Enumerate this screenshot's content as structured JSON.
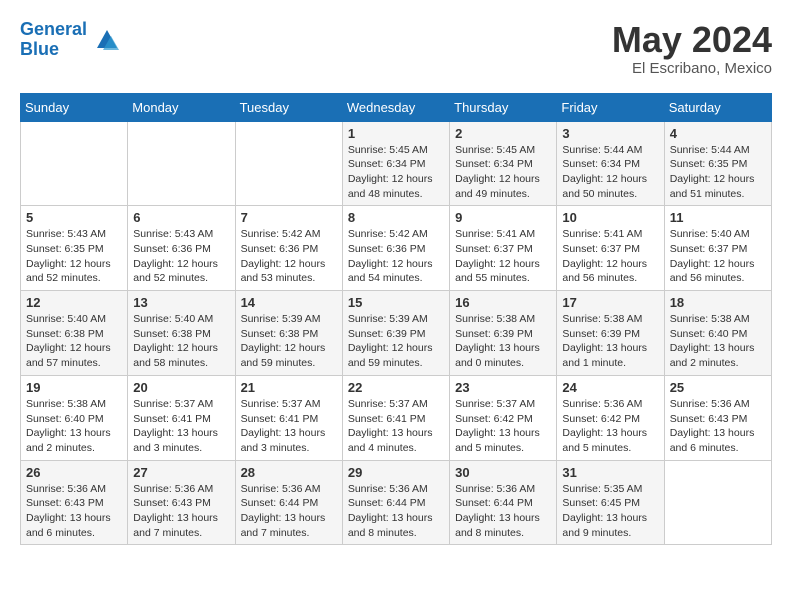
{
  "header": {
    "logo_line1": "General",
    "logo_line2": "Blue",
    "month_title": "May 2024",
    "location": "El Escribano, Mexico"
  },
  "days_of_week": [
    "Sunday",
    "Monday",
    "Tuesday",
    "Wednesday",
    "Thursday",
    "Friday",
    "Saturday"
  ],
  "weeks": [
    [
      {
        "day": "",
        "info": ""
      },
      {
        "day": "",
        "info": ""
      },
      {
        "day": "",
        "info": ""
      },
      {
        "day": "1",
        "info": "Sunrise: 5:45 AM\nSunset: 6:34 PM\nDaylight: 12 hours and 48 minutes."
      },
      {
        "day": "2",
        "info": "Sunrise: 5:45 AM\nSunset: 6:34 PM\nDaylight: 12 hours and 49 minutes."
      },
      {
        "day": "3",
        "info": "Sunrise: 5:44 AM\nSunset: 6:34 PM\nDaylight: 12 hours and 50 minutes."
      },
      {
        "day": "4",
        "info": "Sunrise: 5:44 AM\nSunset: 6:35 PM\nDaylight: 12 hours and 51 minutes."
      }
    ],
    [
      {
        "day": "5",
        "info": "Sunrise: 5:43 AM\nSunset: 6:35 PM\nDaylight: 12 hours and 52 minutes."
      },
      {
        "day": "6",
        "info": "Sunrise: 5:43 AM\nSunset: 6:36 PM\nDaylight: 12 hours and 52 minutes."
      },
      {
        "day": "7",
        "info": "Sunrise: 5:42 AM\nSunset: 6:36 PM\nDaylight: 12 hours and 53 minutes."
      },
      {
        "day": "8",
        "info": "Sunrise: 5:42 AM\nSunset: 6:36 PM\nDaylight: 12 hours and 54 minutes."
      },
      {
        "day": "9",
        "info": "Sunrise: 5:41 AM\nSunset: 6:37 PM\nDaylight: 12 hours and 55 minutes."
      },
      {
        "day": "10",
        "info": "Sunrise: 5:41 AM\nSunset: 6:37 PM\nDaylight: 12 hours and 56 minutes."
      },
      {
        "day": "11",
        "info": "Sunrise: 5:40 AM\nSunset: 6:37 PM\nDaylight: 12 hours and 56 minutes."
      }
    ],
    [
      {
        "day": "12",
        "info": "Sunrise: 5:40 AM\nSunset: 6:38 PM\nDaylight: 12 hours and 57 minutes."
      },
      {
        "day": "13",
        "info": "Sunrise: 5:40 AM\nSunset: 6:38 PM\nDaylight: 12 hours and 58 minutes."
      },
      {
        "day": "14",
        "info": "Sunrise: 5:39 AM\nSunset: 6:38 PM\nDaylight: 12 hours and 59 minutes."
      },
      {
        "day": "15",
        "info": "Sunrise: 5:39 AM\nSunset: 6:39 PM\nDaylight: 12 hours and 59 minutes."
      },
      {
        "day": "16",
        "info": "Sunrise: 5:38 AM\nSunset: 6:39 PM\nDaylight: 13 hours and 0 minutes."
      },
      {
        "day": "17",
        "info": "Sunrise: 5:38 AM\nSunset: 6:39 PM\nDaylight: 13 hours and 1 minute."
      },
      {
        "day": "18",
        "info": "Sunrise: 5:38 AM\nSunset: 6:40 PM\nDaylight: 13 hours and 2 minutes."
      }
    ],
    [
      {
        "day": "19",
        "info": "Sunrise: 5:38 AM\nSunset: 6:40 PM\nDaylight: 13 hours and 2 minutes."
      },
      {
        "day": "20",
        "info": "Sunrise: 5:37 AM\nSunset: 6:41 PM\nDaylight: 13 hours and 3 minutes."
      },
      {
        "day": "21",
        "info": "Sunrise: 5:37 AM\nSunset: 6:41 PM\nDaylight: 13 hours and 3 minutes."
      },
      {
        "day": "22",
        "info": "Sunrise: 5:37 AM\nSunset: 6:41 PM\nDaylight: 13 hours and 4 minutes."
      },
      {
        "day": "23",
        "info": "Sunrise: 5:37 AM\nSunset: 6:42 PM\nDaylight: 13 hours and 5 minutes."
      },
      {
        "day": "24",
        "info": "Sunrise: 5:36 AM\nSunset: 6:42 PM\nDaylight: 13 hours and 5 minutes."
      },
      {
        "day": "25",
        "info": "Sunrise: 5:36 AM\nSunset: 6:43 PM\nDaylight: 13 hours and 6 minutes."
      }
    ],
    [
      {
        "day": "26",
        "info": "Sunrise: 5:36 AM\nSunset: 6:43 PM\nDaylight: 13 hours and 6 minutes."
      },
      {
        "day": "27",
        "info": "Sunrise: 5:36 AM\nSunset: 6:43 PM\nDaylight: 13 hours and 7 minutes."
      },
      {
        "day": "28",
        "info": "Sunrise: 5:36 AM\nSunset: 6:44 PM\nDaylight: 13 hours and 7 minutes."
      },
      {
        "day": "29",
        "info": "Sunrise: 5:36 AM\nSunset: 6:44 PM\nDaylight: 13 hours and 8 minutes."
      },
      {
        "day": "30",
        "info": "Sunrise: 5:36 AM\nSunset: 6:44 PM\nDaylight: 13 hours and 8 minutes."
      },
      {
        "day": "31",
        "info": "Sunrise: 5:35 AM\nSunset: 6:45 PM\nDaylight: 13 hours and 9 minutes."
      },
      {
        "day": "",
        "info": ""
      }
    ]
  ]
}
